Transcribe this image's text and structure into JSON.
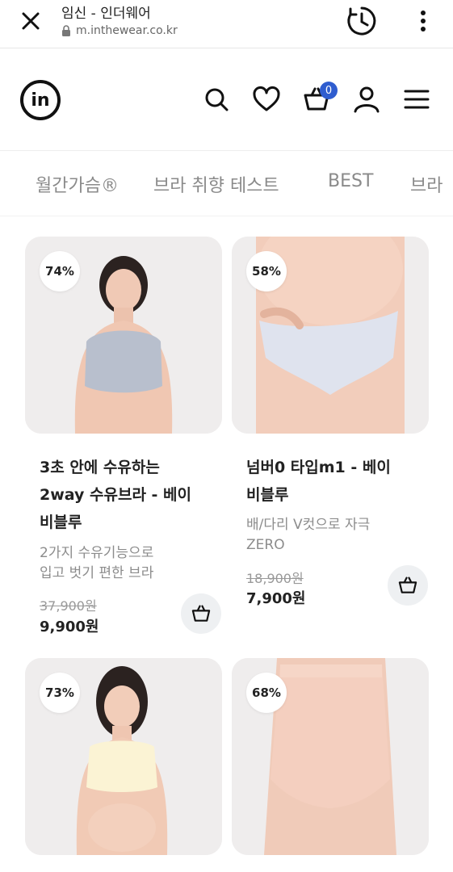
{
  "browser": {
    "page_title": "임신 - 인더웨어",
    "url": "m.inthewear.co.kr"
  },
  "header": {
    "cart_count": "0",
    "logo_text": "in"
  },
  "tabs": [
    "월간가슴®",
    "브라 취향 테스트",
    "BEST",
    "브라"
  ],
  "products": [
    {
      "discount": "74%",
      "name_lines": [
        "3초 안에 수유하는",
        "2way 수유브라 - 베이",
        "비블루"
      ],
      "desc_lines": [
        "2가지 수유기능으로",
        "입고 벗기 편한 브라"
      ],
      "original_price": "37,900원",
      "price": "9,900원"
    },
    {
      "discount": "58%",
      "name_lines": [
        "넘버0 타입m1 - 베이",
        "비블루"
      ],
      "desc_lines": [
        "배/다리 V컷으로 자극",
        "ZERO"
      ],
      "original_price": "18,900원",
      "price": "7,900원"
    },
    {
      "discount": "73%"
    },
    {
      "discount": "68%"
    }
  ],
  "colors": {
    "accent": "#2f5dcf",
    "tab_text": "#8a8a8a",
    "price_text": "#222222",
    "strike_text": "#999999"
  }
}
